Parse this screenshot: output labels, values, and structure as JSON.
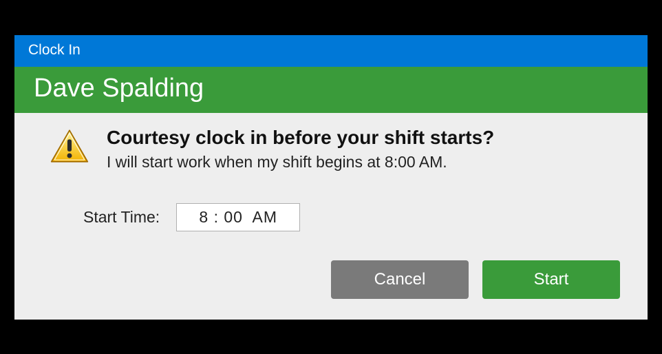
{
  "titlebar": {
    "title": "Clock In"
  },
  "user": {
    "name": "Dave Spalding"
  },
  "message": {
    "heading": "Courtesy clock in before your shift starts?",
    "body": "I will start work when my shift begins at 8:00 AM."
  },
  "form": {
    "start_time_label": "Start Time:",
    "start_time_value": "8 : 00  AM"
  },
  "buttons": {
    "cancel": "Cancel",
    "start": "Start"
  },
  "colors": {
    "title_blue": "#0078d7",
    "user_green": "#3a9b3a",
    "bg_grey": "#eeeeee",
    "btn_grey": "#7a7a7a"
  },
  "icons": {
    "warning": "warning-triangle"
  }
}
